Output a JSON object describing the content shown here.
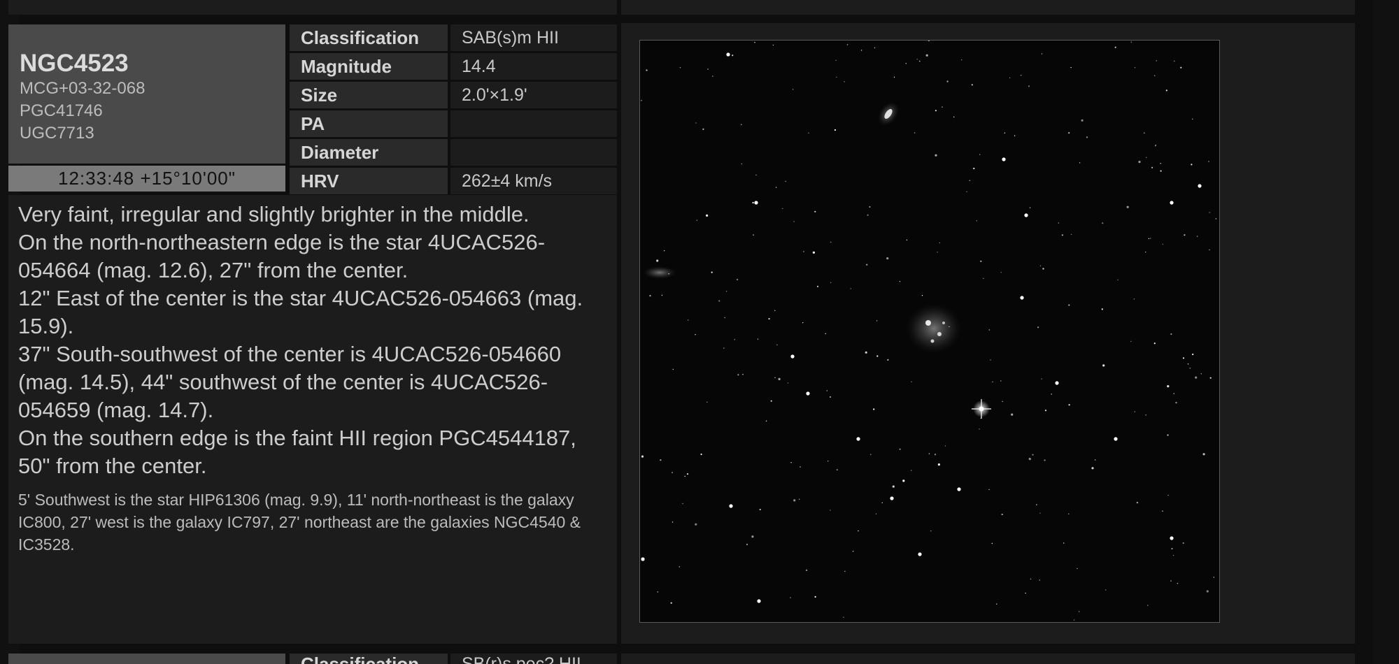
{
  "object": {
    "name": "NGC4523",
    "aliases": [
      "MCG+03-32-068",
      "PGC41746",
      "UGC7713"
    ],
    "coordinates": "12:33:48 +15°10'00\""
  },
  "properties": [
    {
      "label": "Classification",
      "value": "SAB(s)m HII"
    },
    {
      "label": "Magnitude",
      "value": "14.4"
    },
    {
      "label": "Size",
      "value": "2.0'×1.9'"
    },
    {
      "label": "PA",
      "value": ""
    },
    {
      "label": "Diameter",
      "value": ""
    },
    {
      "label": "HRV",
      "value": "262±4 km/s"
    }
  ],
  "description": {
    "lines": [
      "Very faint, irregular and slightly brighter in the middle.",
      "On the north-northeastern edge is the star 4UCAC526-054664 (mag. 12.6), 27\" from the center.",
      "12\" East of the center is the star 4UCAC526-054663 (mag. 15.9).",
      "37\" South-southwest of the center is 4UCAC526-054660 (mag. 14.5), 44\" southwest of the center is 4UCAC526-054659 (mag. 14.7).",
      "On the southern edge is the faint HII region PGC4544187, 50\" from the center."
    ],
    "note": "5' Southwest is the star HIP61306 (mag. 9.9), 11' north-northeast is the galaxy IC800, 27' west is the galaxy IC797, 27' northeast are the galaxies NGC4540 & IC3528."
  },
  "next_entry": {
    "first_label": "Classification",
    "first_value": "SB(r)s pec? HII"
  },
  "colors": {
    "background": "#111111",
    "panel": "#1c1c1c",
    "name_box": "#4a4a4a",
    "coords_box": "#7a7a7a"
  }
}
